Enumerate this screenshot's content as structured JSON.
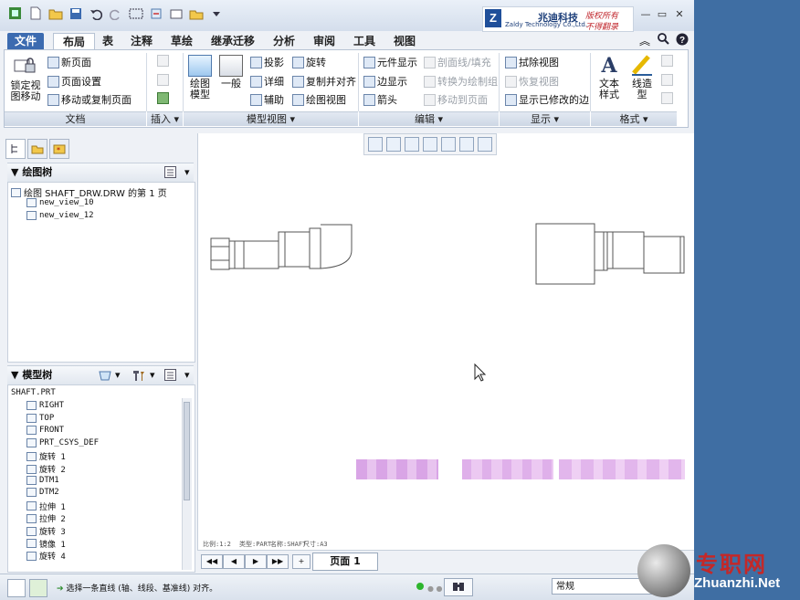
{
  "brand": {
    "logo_letter": "Z",
    "name_cn": "兆迪科技",
    "name_en": "Zaldy Technology Co.,Ltd.",
    "right_top": "版权所有",
    "right_bottom": "不得翻录"
  },
  "tabs": [
    "文件",
    "布局",
    "表",
    "注释",
    "草绘",
    "继承迁移",
    "分析",
    "审阅",
    "工具",
    "视图"
  ],
  "active_tab": "布局",
  "ribbon": {
    "doc": {
      "lock_label_1": "锁定视",
      "lock_label_2": "图移动",
      "new_page": "新页面",
      "page_setup": "页面设置",
      "move_copy_page": "移动或复制页面",
      "group": "文档"
    },
    "insert": {
      "group": "插入"
    },
    "model_view": {
      "drawing_model_1": "绘图",
      "drawing_model_2": "模型",
      "general": "一般",
      "projection": "投影",
      "detail": "详细",
      "auxiliary": "辅助",
      "revolve": "旋转",
      "copy_align": "复制并对齐",
      "drawing_view": "绘图视图",
      "group": "模型视图"
    },
    "edit": {
      "element_display": "元件显示",
      "edge_display": "边显示",
      "arrow": "箭头",
      "section_fill": "剖面线/填充",
      "convert_drawing": "转换为绘制组",
      "move_to_page": "移动到页面",
      "group": "编辑"
    },
    "display": {
      "erase_view": "拭除视图",
      "restore_view": "恢复视图",
      "show_modified_edges": "显示已修改的边",
      "group": "显示"
    },
    "format": {
      "text_style_1": "文本",
      "text_style_2": "样式",
      "line_style_1": "线造",
      "line_style_2": "型",
      "group": "格式"
    }
  },
  "drawing_tree": {
    "header": "绘图树",
    "root": "绘图 SHAFT_DRW.DRW 的第 1 页",
    "items": [
      "new_view_10",
      "new_view_12"
    ]
  },
  "model_tree": {
    "header": "模型树",
    "root": "SHAFT.PRT",
    "items": [
      "RIGHT",
      "TOP",
      "FRONT",
      "PRT_CSYS_DEF",
      "旋转 1",
      "旋转 2",
      "DTM1",
      "DTM2",
      "拉伸 1",
      "拉伸 2",
      "旋转 3",
      "镜像 1",
      "旋转 4"
    ]
  },
  "sheet_info": {
    "scale": "比例:1:2",
    "type": "类型:PART",
    "name": "名称:SHAFT",
    "size": "尺寸:A3"
  },
  "page": {
    "label": "页面 1"
  },
  "status": {
    "message": "选择一条直线 (轴、线段、基准线) 对齐。",
    "filter": "常规"
  },
  "watermark": {
    "cn": "专职网",
    "en": "Zhuanzhi.Net"
  }
}
